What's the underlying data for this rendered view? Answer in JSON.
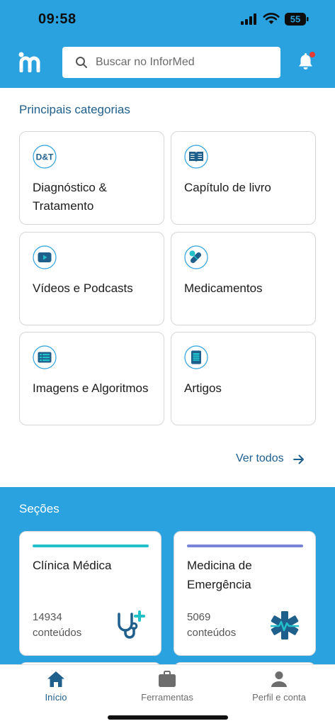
{
  "status_bar": {
    "time": "09:58",
    "battery": "55"
  },
  "header": {
    "logo": "informed-logo",
    "search_placeholder": "Buscar no InforMed",
    "notification_icon": "bell-icon",
    "notification_dot_color": "#e53935"
  },
  "colors": {
    "brand_blue": "#2ba2e0",
    "dark_blue": "#1f5f8c",
    "teal": "#22c0c9",
    "purple": "#7a84d8"
  },
  "categories": {
    "title": "Principais categorias",
    "items": [
      {
        "label": "Diagnóstico & Tratamento",
        "icon": "dt-icon",
        "icon_text": "D&T"
      },
      {
        "label": "Capítulo de livro",
        "icon": "book-icon"
      },
      {
        "label": "Vídeos e Podcasts",
        "icon": "play-icon"
      },
      {
        "label": "Medicamentos",
        "icon": "pill-icon"
      },
      {
        "label": "Imagens e Algoritmos",
        "icon": "image-list-icon"
      },
      {
        "label": "Artigos",
        "icon": "article-icon"
      }
    ],
    "see_all": "Ver todos"
  },
  "sections": {
    "title": "Seções",
    "items": [
      {
        "name": "Clínica Médica",
        "count": "14934",
        "unit": "conteúdos",
        "icon": "stethoscope-icon",
        "accent": "#22c0c9"
      },
      {
        "name": "Medicina de Emergência",
        "count": "5069",
        "unit": "conteúdos",
        "icon": "star-of-life-icon",
        "accent": "#7a84d8"
      }
    ]
  },
  "bottom_nav": {
    "items": [
      {
        "label": "Início",
        "icon": "home-icon",
        "active": true
      },
      {
        "label": "Ferramentas",
        "icon": "briefcase-icon",
        "active": false
      },
      {
        "label": "Perfil e conta",
        "icon": "person-icon",
        "active": false
      }
    ]
  }
}
